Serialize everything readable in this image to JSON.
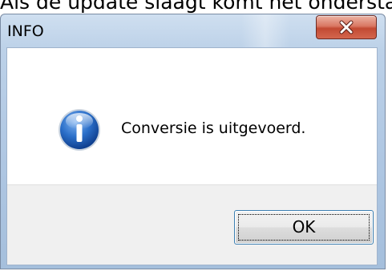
{
  "caption": {
    "text": "Als de update slaagt komt het onderstaande"
  },
  "dialog": {
    "title": "INFO",
    "message": "Conversie is uitgevoerd.",
    "icon": "info-icon",
    "ok_label": "OK",
    "close_icon": "close-icon"
  },
  "colors": {
    "title_bar": "#b9cfe7",
    "close_button": "#c9503a",
    "info_icon": "#1d5fb8",
    "button_area": "#f0f0f0",
    "focus_border": "#3c7fb1"
  }
}
